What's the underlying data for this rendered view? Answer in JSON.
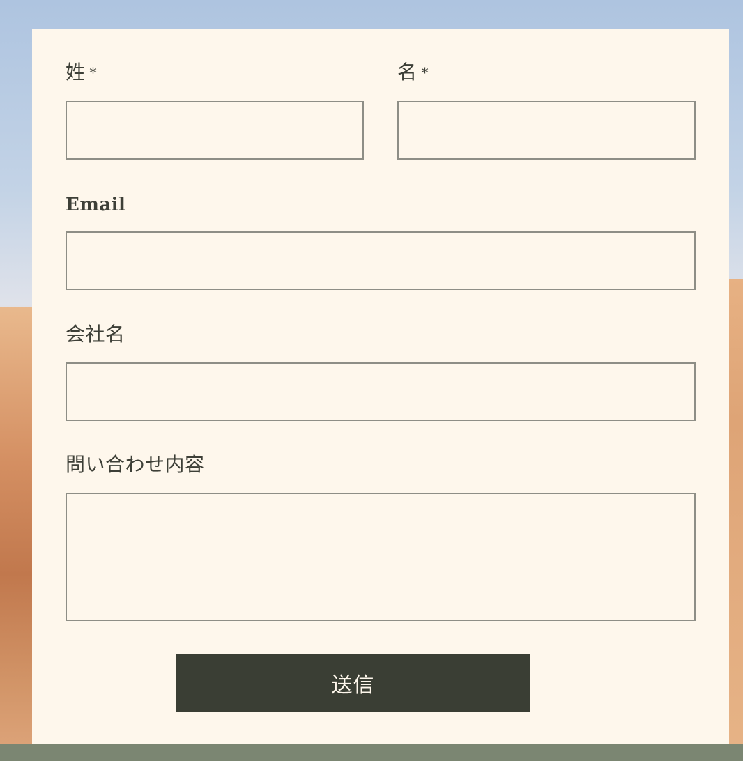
{
  "form": {
    "last_name": {
      "label": "姓",
      "required_mark": "*",
      "value": ""
    },
    "first_name": {
      "label": "名",
      "required_mark": "*",
      "value": ""
    },
    "email": {
      "label": "Email",
      "value": ""
    },
    "company": {
      "label": "会社名",
      "value": ""
    },
    "message": {
      "label": "問い合わせ内容",
      "value": ""
    },
    "submit_label": "送信"
  },
  "colors": {
    "card_background": "#fef7ec",
    "field_border": "#8e8e86",
    "button_background": "#3a3e34",
    "button_text": "#fef7ec",
    "label_text": "#3d3f37"
  }
}
